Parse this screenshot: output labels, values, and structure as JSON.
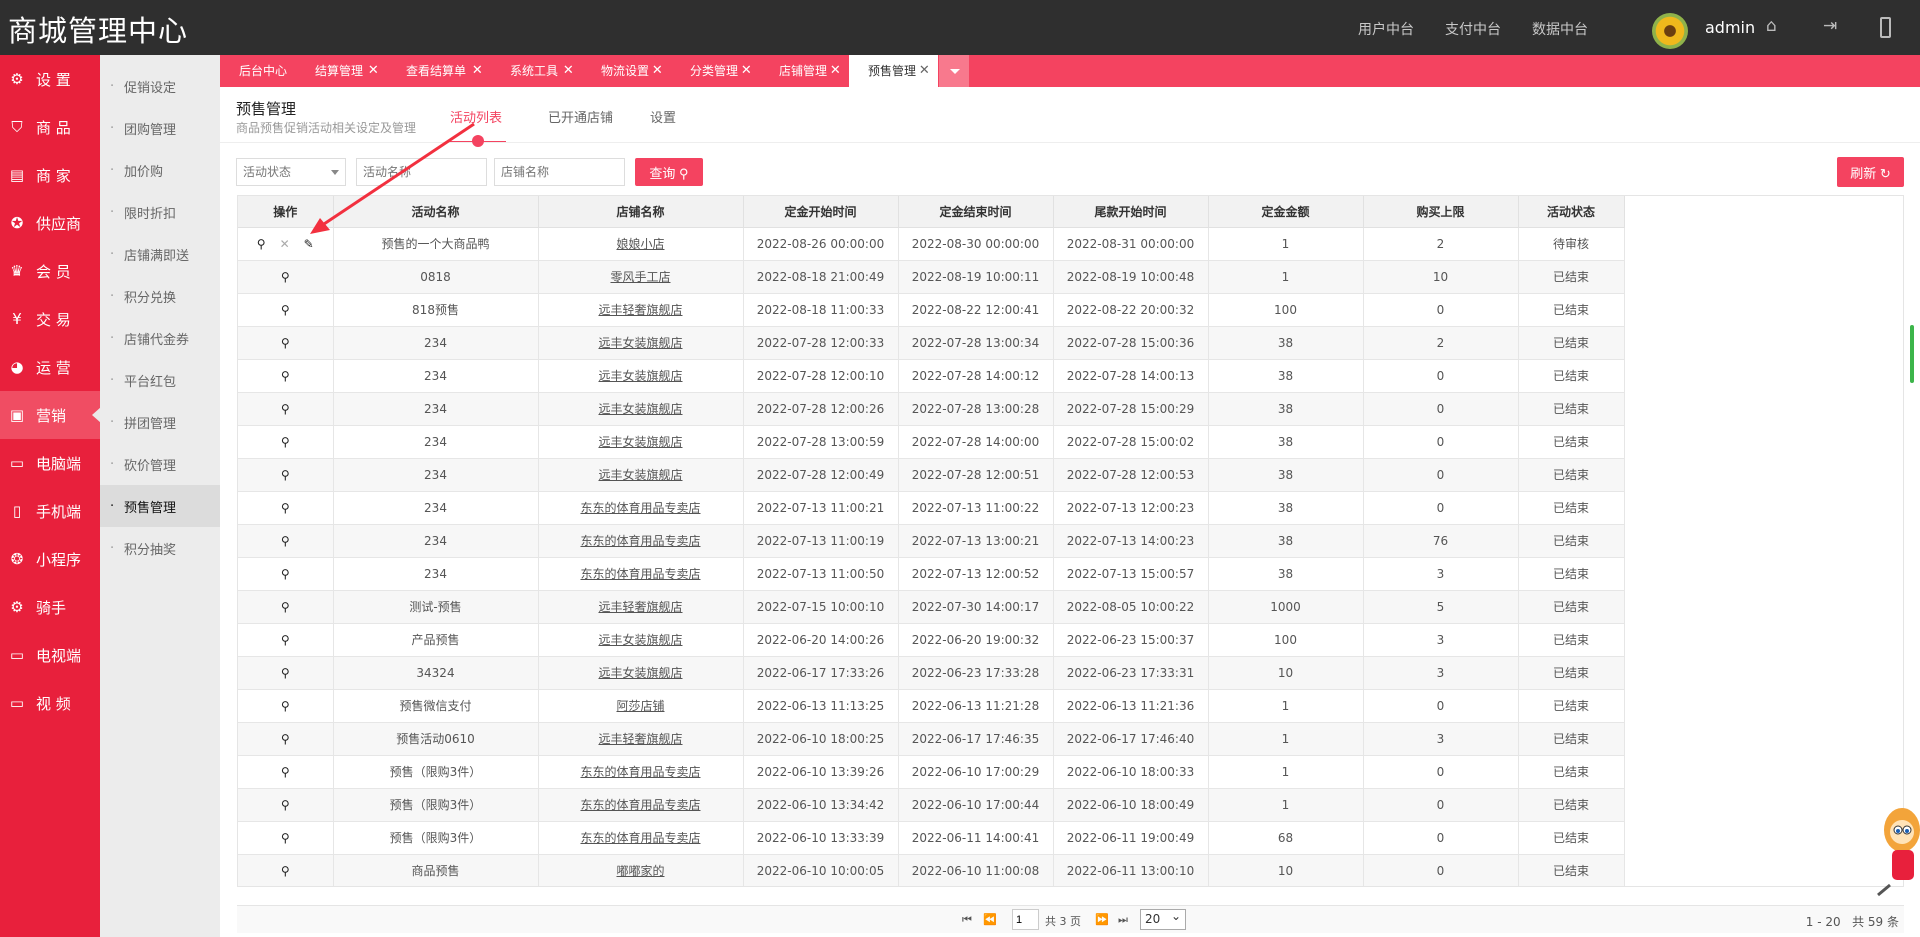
{
  "app": {
    "title": "商城管理中心",
    "top_nav": [
      "用户中台",
      "支付中台",
      "数据中台"
    ],
    "username": "admin"
  },
  "sidebar": [
    {
      "label": "设 置",
      "icon": "gear-icon"
    },
    {
      "label": "商 品",
      "icon": "shopping-basket-icon"
    },
    {
      "label": "商 家",
      "icon": "store-icon"
    },
    {
      "label": "供应商",
      "icon": "supplier-icon"
    },
    {
      "label": "会 员",
      "icon": "crown-icon"
    },
    {
      "label": "交 易",
      "icon": "yen-icon"
    },
    {
      "label": "运 营",
      "icon": "pie-chart-icon"
    },
    {
      "label": "营销",
      "icon": "marketing-icon"
    },
    {
      "label": "电脑端",
      "icon": "monitor-icon"
    },
    {
      "label": "手机端",
      "icon": "mobile-icon"
    },
    {
      "label": "小程序",
      "icon": "mini-program-icon"
    },
    {
      "label": "骑手",
      "icon": "rider-icon"
    },
    {
      "label": "电视端",
      "icon": "tv-icon"
    },
    {
      "label": "视 频",
      "icon": "video-icon"
    }
  ],
  "submenu": [
    "促销设定",
    "团购管理",
    "加价购",
    "限时折扣",
    "店铺满即送",
    "积分兑换",
    "店铺代金券",
    "平台红包",
    "拼团管理",
    "砍价管理",
    "预售管理",
    "积分抽奖"
  ],
  "tabs": [
    "后台中心",
    "结算管理",
    "查看结算单",
    "系统工具",
    "物流设置",
    "分类管理",
    "店铺管理",
    "预售管理"
  ],
  "page": {
    "title": "预售管理",
    "subtitle": "商品预售促销活动相关设定及管理",
    "subtabs": [
      "活动列表",
      "已开通店铺",
      "设置"
    ]
  },
  "filters": {
    "status_select": "活动状态",
    "name_placeholder": "活动名称",
    "shop_placeholder": "店铺名称",
    "search_label": "查询",
    "refresh_label": "刷新"
  },
  "table": {
    "headers": [
      "操作",
      "活动名称",
      "店铺名称",
      "定金开始时间",
      "定金结束时间",
      "尾款开始时间",
      "定金金额",
      "购买上限",
      "活动状态"
    ],
    "rows": [
      [
        "预售的一个大商品鸭",
        "娘娘小店",
        "2022-08-26 00:00:00",
        "2022-08-30 00:00:00",
        "2022-08-31 00:00:00",
        "1",
        "2",
        "待审核"
      ],
      [
        "0818",
        "零风手工店",
        "2022-08-18 21:00:49",
        "2022-08-19 10:00:11",
        "2022-08-19 10:00:48",
        "1",
        "10",
        "已结束"
      ],
      [
        "818预售",
        "远丰轻奢旗舰店",
        "2022-08-18 11:00:33",
        "2022-08-22 12:00:41",
        "2022-08-22 20:00:32",
        "100",
        "0",
        "已结束"
      ],
      [
        "234",
        "远丰女装旗舰店",
        "2022-07-28 12:00:33",
        "2022-07-28 13:00:34",
        "2022-07-28 15:00:36",
        "38",
        "2",
        "已结束"
      ],
      [
        "234",
        "远丰女装旗舰店",
        "2022-07-28 12:00:10",
        "2022-07-28 14:00:12",
        "2022-07-28 14:00:13",
        "38",
        "0",
        "已结束"
      ],
      [
        "234",
        "远丰女装旗舰店",
        "2022-07-28 12:00:26",
        "2022-07-28 13:00:28",
        "2022-07-28 15:00:29",
        "38",
        "0",
        "已结束"
      ],
      [
        "234",
        "远丰女装旗舰店",
        "2022-07-28 13:00:59",
        "2022-07-28 14:00:00",
        "2022-07-28 15:00:02",
        "38",
        "0",
        "已结束"
      ],
      [
        "234",
        "远丰女装旗舰店",
        "2022-07-28 12:00:49",
        "2022-07-28 12:00:51",
        "2022-07-28 12:00:53",
        "38",
        "0",
        "已结束"
      ],
      [
        "234",
        "东东的体育用品专卖店",
        "2022-07-13 11:00:21",
        "2022-07-13 11:00:22",
        "2022-07-13 12:00:23",
        "38",
        "0",
        "已结束"
      ],
      [
        "234",
        "东东的体育用品专卖店",
        "2022-07-13 11:00:19",
        "2022-07-13 13:00:21",
        "2022-07-13 14:00:23",
        "38",
        "76",
        "已结束"
      ],
      [
        "234",
        "东东的体育用品专卖店",
        "2022-07-13 11:00:50",
        "2022-07-13 12:00:52",
        "2022-07-13 15:00:57",
        "38",
        "3",
        "已结束"
      ],
      [
        "测试-预售",
        "远丰轻奢旗舰店",
        "2022-07-15 10:00:10",
        "2022-07-30 14:00:17",
        "2022-08-05 10:00:22",
        "1000",
        "5",
        "已结束"
      ],
      [
        "产品预售",
        "远丰女装旗舰店",
        "2022-06-20 14:00:26",
        "2022-06-20 19:00:32",
        "2022-06-23 15:00:37",
        "100",
        "3",
        "已结束"
      ],
      [
        "34324",
        "远丰女装旗舰店",
        "2022-06-17 17:33:26",
        "2022-06-23 17:33:28",
        "2022-06-23 17:33:31",
        "10",
        "3",
        "已结束"
      ],
      [
        "预售微信支付",
        "阿莎店铺",
        "2022-06-13 11:13:25",
        "2022-06-13 11:21:28",
        "2022-06-13 11:21:36",
        "1",
        "0",
        "已结束"
      ],
      [
        "预售活动0610",
        "远丰轻奢旗舰店",
        "2022-06-10 18:00:25",
        "2022-06-17 17:46:35",
        "2022-06-17 17:46:40",
        "1",
        "3",
        "已结束"
      ],
      [
        "预售（限购3件）",
        "东东的体育用品专卖店",
        "2022-06-10 13:39:26",
        "2022-06-10 17:00:29",
        "2022-06-10 18:00:33",
        "1",
        "0",
        "已结束"
      ],
      [
        "预售（限购3件）",
        "东东的体育用品专卖店",
        "2022-06-10 13:34:42",
        "2022-06-10 17:00:44",
        "2022-06-10 18:00:49",
        "1",
        "0",
        "已结束"
      ],
      [
        "预售（限购3件）",
        "东东的体育用品专卖店",
        "2022-06-10 13:33:39",
        "2022-06-11 14:00:41",
        "2022-06-11 19:00:49",
        "68",
        "0",
        "已结束"
      ],
      [
        "商品预售",
        "嘟嘟家的",
        "2022-06-10 10:00:05",
        "2022-06-10 11:00:08",
        "2022-06-11 13:00:10",
        "10",
        "0",
        "已结束"
      ]
    ]
  },
  "pagination": {
    "page_value": "1",
    "total_pages": "共 3 页",
    "page_size": "20",
    "range_info": "1 - 20",
    "total_info": "共 59 条"
  },
  "colors": {
    "brand_red": "#e8203c",
    "tab_red": "#f44360",
    "topbar_dark": "#2f2f2f"
  }
}
